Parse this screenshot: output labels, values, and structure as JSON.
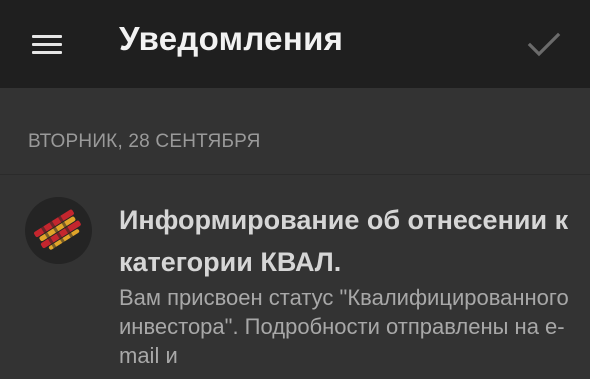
{
  "toolbar": {
    "menu_icon": "hamburger-menu-icon",
    "title": "Уведомления",
    "check_icon": "checkmark-icon"
  },
  "section": {
    "date_label": "ВТОРНИК, 28 СЕНТЯБРЯ"
  },
  "notifications": [
    {
      "icon": "broker-logo-icon",
      "title": "Информирование об отнесении к категории КВАЛ.",
      "body": "Вам присвоен статус \"Квалифицированного инвестора\". Подробности отправлены на e-mail и"
    }
  ],
  "colors": {
    "toolbar_bg": "#1f1f1f",
    "page_bg": "#333333",
    "logo_gold": "#e0a52a",
    "logo_red": "#c4262e"
  }
}
